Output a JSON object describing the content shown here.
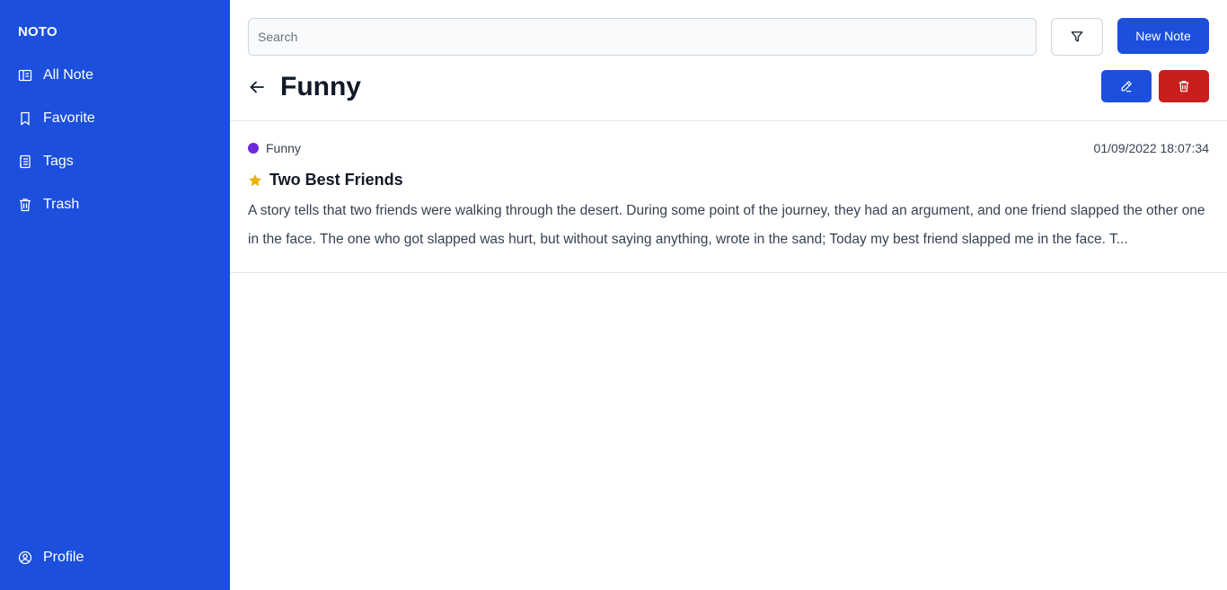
{
  "app": {
    "brand": "NOTO"
  },
  "sidebar": {
    "items": [
      {
        "label": "All Note",
        "icon": "book-icon"
      },
      {
        "label": "Favorite",
        "icon": "bookmark-icon"
      },
      {
        "label": "Tags",
        "icon": "tag-list-icon"
      },
      {
        "label": "Trash",
        "icon": "trash-icon"
      }
    ],
    "profile": {
      "label": "Profile",
      "icon": "user-circle-icon"
    }
  },
  "toolbar": {
    "search_placeholder": "Search",
    "search_value": "",
    "filter_icon": "filter-icon",
    "new_note_label": "New Note"
  },
  "header": {
    "title": "Funny",
    "back_icon": "arrow-left-icon",
    "edit_icon": "pencil-icon",
    "delete_icon": "trash-icon"
  },
  "notes": [
    {
      "tag": "Funny",
      "tag_color": "#6d28d9",
      "date": "01/09/2022 18:07:34",
      "favorite": true,
      "title": "Two Best Friends",
      "excerpt": "A story tells that two friends were walking through the desert. During some point of the journey, they had an argument, and one friend slapped the other one in the face. The one who got slapped was hurt, but without saying anything, wrote in the sand; Today my best friend slapped me in the face. T..."
    }
  ],
  "colors": {
    "sidebar_bg": "#1b4fdc",
    "primary": "#1b4fdc",
    "danger": "#c81e1e",
    "star": "#eab308"
  }
}
